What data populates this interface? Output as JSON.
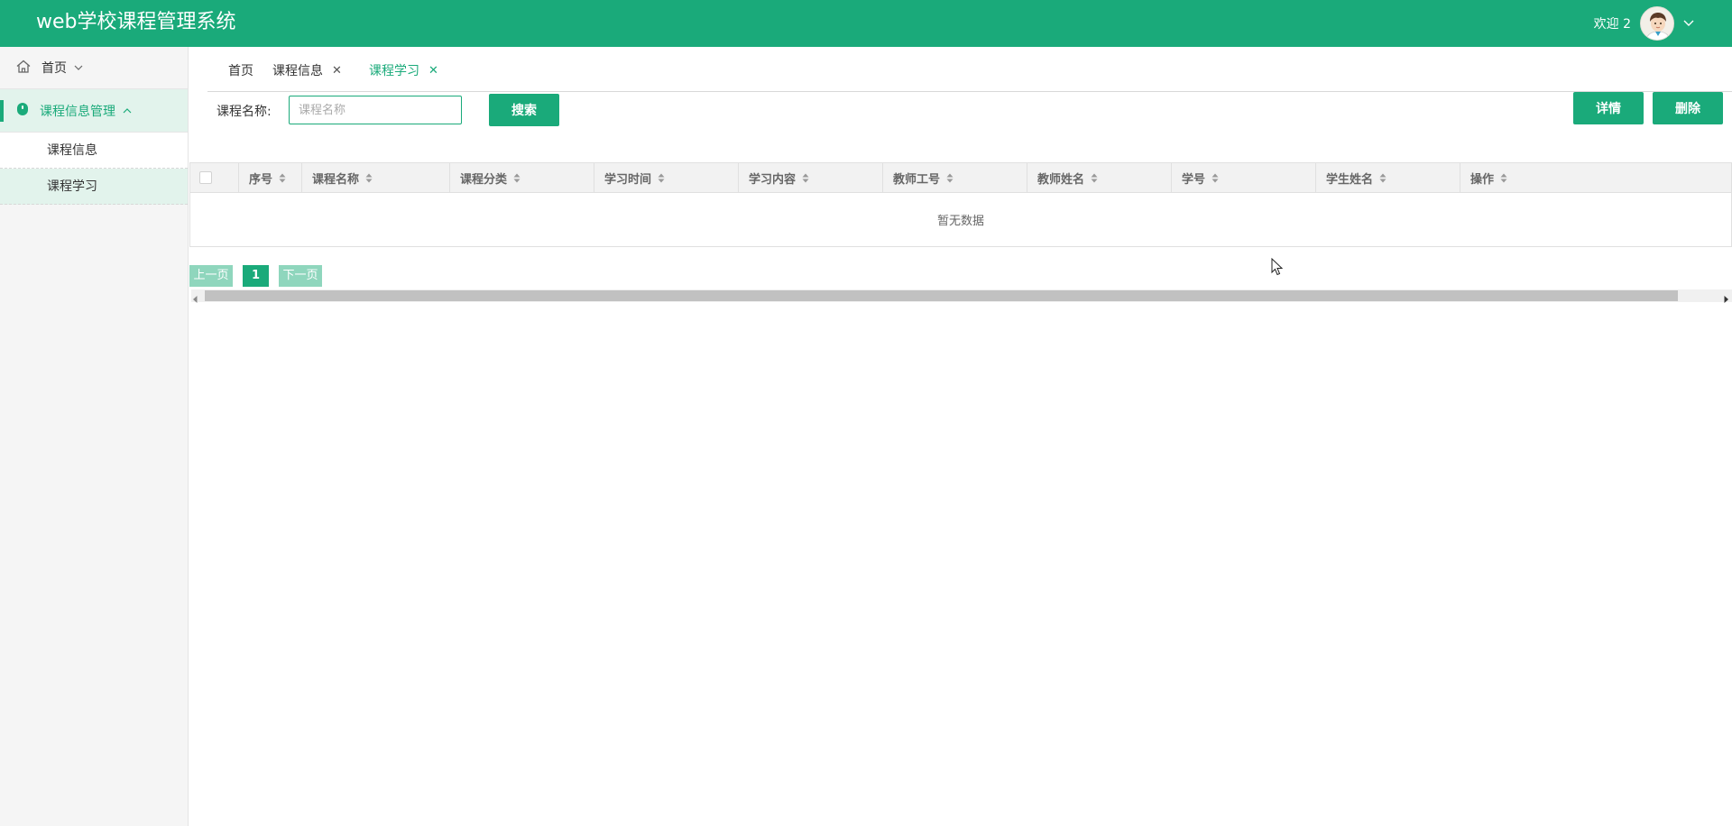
{
  "header": {
    "app_title": "web学校课程管理系统",
    "welcome": "欢迎 2",
    "avatar_icon": "user-avatar-icon",
    "menu_icon": "chevron-down-icon",
    "bg_color": "#1aaa7a"
  },
  "sidebar": {
    "home": {
      "label": "首页",
      "icon": "home-icon"
    },
    "group": {
      "label": "课程信息管理",
      "icon": "course-icon"
    },
    "items": [
      {
        "label": "课程信息",
        "active": false
      },
      {
        "label": "课程学习",
        "active": true
      }
    ]
  },
  "tabs": [
    {
      "label": "首页",
      "closable": false,
      "active": false
    },
    {
      "label": "课程信息",
      "closable": true,
      "close": "✕",
      "active": false
    },
    {
      "label": "课程学习",
      "closable": true,
      "close": "✕",
      "active": true
    }
  ],
  "search": {
    "label": "课程名称:",
    "placeholder": "课程名称",
    "value": "",
    "button": "搜索"
  },
  "actions": {
    "detail": "详情",
    "delete": "删除"
  },
  "table": {
    "columns": [
      "序号",
      "课程名称",
      "课程分类",
      "学习时间",
      "学习内容",
      "教师工号",
      "教师姓名",
      "学号",
      "学生姓名",
      "操作"
    ],
    "rows": [],
    "empty_text": "暂无数据"
  },
  "pagination": {
    "prev": "上一页",
    "current": "1",
    "next": "下一页"
  },
  "colors": {
    "accent": "#1aaa7a",
    "accent_light": "#8fd6bd",
    "active_bg": "#e2f3ec"
  }
}
